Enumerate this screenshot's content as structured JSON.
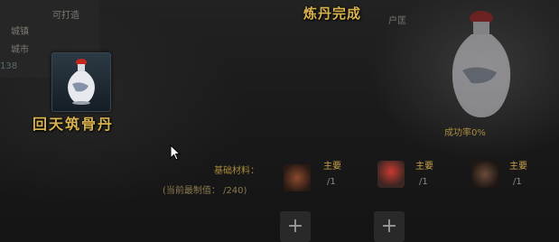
{
  "header": {
    "title": "炼丹完成"
  },
  "left_panel": {
    "faded_label": "可打造",
    "faded_list": [
      "城镇",
      "城市",
      "138"
    ],
    "item_name": "回天筑骨丹",
    "item_icon": "porcelain-vase-icon"
  },
  "right_panel": {
    "faded_tag": "户匡",
    "success_rate": "成功率0%"
  },
  "materials": {
    "label": "基础材料：",
    "capacity_label": "(当前最制值： /240)",
    "items": [
      {
        "name": "主要",
        "count": "/1",
        "icon": "brown-pouch-icon"
      },
      {
        "name": "主要",
        "count": "/1",
        "icon": "red-bottle-icon"
      },
      {
        "name": "主要",
        "count": "/1",
        "icon": "dark-herb-icon"
      }
    ]
  },
  "add_slots": [
    "+",
    "+"
  ],
  "colors": {
    "gold": "#d8b24c",
    "dim_gold": "#a98a3e",
    "background": "#1b1b1b"
  }
}
